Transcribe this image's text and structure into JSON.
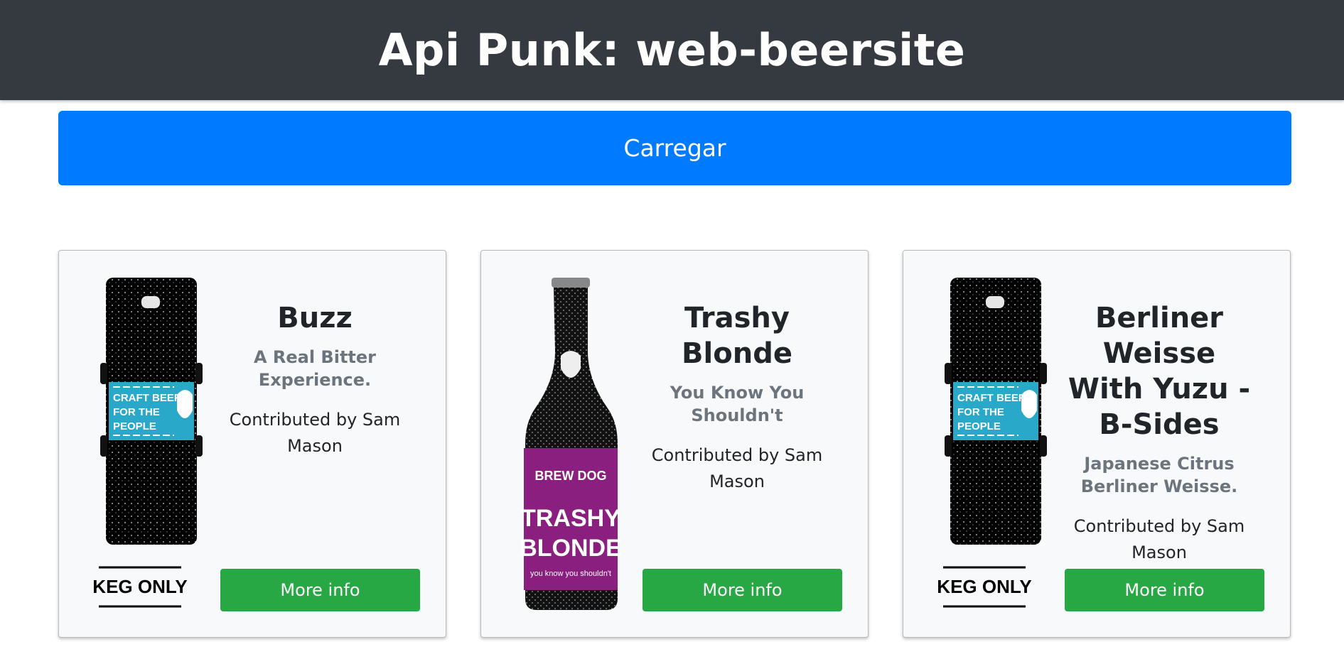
{
  "header": {
    "title": "Api Punk: web-beersite"
  },
  "load_button": {
    "label": "Carregar"
  },
  "beers": [
    {
      "name": "Buzz",
      "tagline": "A Real Bitter Experience.",
      "contributed": "Contributed by Sam Mason",
      "image": "keg-icon",
      "keg_label": [
        "CRAFT BEER",
        "FOR THE",
        "PEOPLE"
      ],
      "keg_footer": "KEG ONLY",
      "button": "More info"
    },
    {
      "name": "Trashy Blonde",
      "tagline": "You Know You Shouldn't",
      "contributed": "Contributed by Sam Mason",
      "image": "bottle-icon",
      "bottle_label": [
        "BREW DOG",
        "TRASHY",
        "BLONDE",
        "you know you shouldn't"
      ],
      "button": "More info"
    },
    {
      "name": "Berliner Weisse With Yuzu - B-Sides",
      "tagline": "Japanese Citrus Berliner Weisse.",
      "contributed": "Contributed by Sam Mason",
      "image": "keg-icon",
      "keg_label": [
        "CRAFT BEER",
        "FOR THE",
        "PEOPLE"
      ],
      "keg_footer": "KEG ONLY",
      "button": "More info"
    }
  ],
  "colors": {
    "navbar": "#343a40",
    "primary": "#007bff",
    "success": "#28a745",
    "card_bg": "#f8f9fa",
    "keg_label": "#29a8c9",
    "bottle_label": "#8a1f7f"
  }
}
